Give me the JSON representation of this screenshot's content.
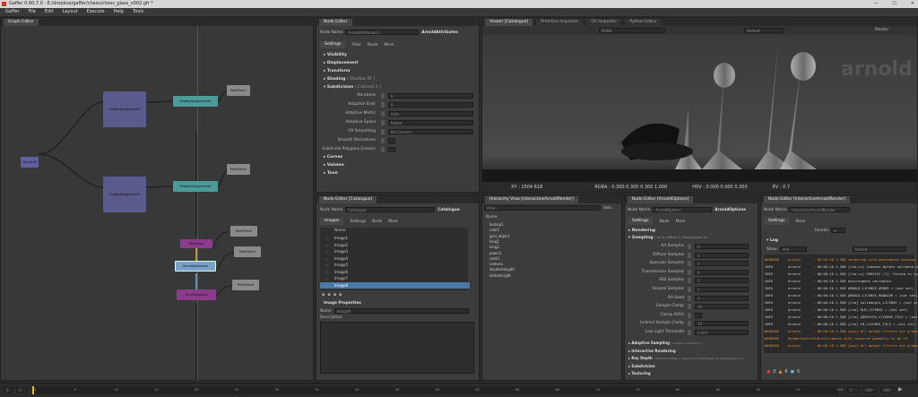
{
  "window": {
    "title": "Gaffer 0.60.7.0 : E:/dropbox/gaffer/chess/chess_glass_v002.gfr *",
    "min": "—",
    "max": "☐",
    "close": "✕"
  },
  "menu": [
    "Gaffer",
    "File",
    "Edit",
    "Layout",
    "Execute",
    "Help",
    "Tools"
  ],
  "graph_editor": {
    "tab": "Graph Editor",
    "nodes": {
      "group": "Group16",
      "sbs1": "ShaderAssignment1",
      "sbs2": "ShaderAssignment2",
      "sbs3": "ShaderAssignment3",
      "sbs4": "ShaderAssignment4",
      "path1": "PathFilter1",
      "path2": "PathFilter2",
      "mesh": "MeshType",
      "attrs": "ArnoldAttributes",
      "opts": "ArnoldOptions",
      "pf3": "PathFilter3",
      "pf4": "PathFilter4",
      "pf5": "PathFilter5"
    }
  },
  "node_editor_top": {
    "tab": "Node Editor",
    "name_label": "Node Name",
    "name_value": "ArnoldAttributes1",
    "type": "ArnoldAttributes",
    "tabs": [
      "Settings",
      "Filter",
      "Node",
      "More"
    ],
    "sections": [
      "Visibility",
      "Displacement",
      "Transform"
    ],
    "shading": "Shading",
    "shading_sub": "( Shadow RT )",
    "subdiv": "Subdivision",
    "subdiv_sub": "( Catclark 1 )",
    "params": [
      {
        "label": "Iterations",
        "value": "0"
      },
      {
        "label": "Adaptive Error",
        "value": "0"
      },
      {
        "label": "Adaptive Metric",
        "value": "Auto"
      },
      {
        "label": "Adaptive Space",
        "value": "Raster"
      },
      {
        "label": "UV Smoothing",
        "value": "Pin Corners"
      },
      {
        "label": "Smooth Derivatives",
        "value": ""
      },
      {
        "label": "Subdivide Polygons (Linear)",
        "value": ""
      }
    ],
    "bottom_sections": [
      "Curves",
      "Volume",
      "Toon"
    ]
  },
  "viewer": {
    "tabs": [
      "Viewer [Catalogue]",
      "Primitive Inspector",
      "UV Inspector",
      "Python Editor"
    ],
    "channel": "RGBA",
    "display": "Default",
    "render_label": "Render",
    "status": {
      "xy": "XY : 1504 618",
      "rgba": "RGBA : 0.300 0.300 0.300 1.000",
      "hsv": "HSV : 0.000 0.000 0.300",
      "ev": "EV : 0.7"
    },
    "watermark": "arnold",
    "watermark2": "arnold"
  },
  "catalogue_editor": {
    "tab": "Node Editor [Catalogue]",
    "name_label": "Node Name",
    "name_value": "Catalogue",
    "type": "Catalogue",
    "tabs": [
      "Images",
      "Settings",
      "Node",
      "More"
    ],
    "col": "Name",
    "images": [
      "Image1",
      "Image2",
      "Image3",
      "Image4",
      "Image5",
      "Image6",
      "Image7",
      "Image8"
    ],
    "props_title": "Image Properties",
    "prop_name_label": "Name",
    "prop_name_value": "Image8",
    "desc_label": "Description"
  },
  "hierarchy": {
    "tab": "Hierarchy View [InteractiveArnoldRender]",
    "filter_ph": "Filter...",
    "sets": "Sets",
    "col": "Name",
    "items": [
      "bishop1",
      "cam1",
      "grid_object",
      "king1",
      "king2",
      "pawn1",
      "rook1",
      "camera",
      "skydomeLight",
      "distantLight"
    ]
  },
  "options_editor": {
    "tab": "Node Editor [ArnoldOptions]",
    "name_label": "Node Name",
    "name_value": "ArnoldOptions",
    "type": "ArnoldOptions",
    "tabs": [
      "Settings",
      "Node",
      "More"
    ],
    "rendering": "Rendering",
    "sampling": "Sampling",
    "sampling_sub": "( AA 6, Diffuse 3, Transmission 6 )",
    "params": [
      {
        "label": "AA Samples",
        "value": "6"
      },
      {
        "label": "Diffuse Samples",
        "value": "3"
      },
      {
        "label": "Specular Samples",
        "value": "2"
      },
      {
        "label": "Transmission Samples",
        "value": "6"
      },
      {
        "label": "SSS Samples",
        "value": "2"
      },
      {
        "label": "Volume Samples",
        "value": "2"
      },
      {
        "label": "AA Seed",
        "value": "1"
      },
      {
        "label": "Sample Clamp",
        "value": "10"
      },
      {
        "label": "Clamp AOVs",
        "value": ""
      },
      {
        "label": "Indirect Sample Clamp",
        "value": "10"
      },
      {
        "label": "Low Light Threshold",
        "value": "0.001"
      }
    ],
    "bottom": [
      {
        "t": "Adaptive Sampling",
        "s": "( Enable 1, AA Max 5 )"
      },
      {
        "t": "Interactive Rendering",
        "s": ""
      },
      {
        "t": "Ray Depth",
        "s": "( Total 10, Diffuse 1, Specular 4, Transmission 8, Transparency 10 )"
      },
      {
        "t": "Subdivision",
        "s": ""
      },
      {
        "t": "Texturing",
        "s": ""
      }
    ]
  },
  "render_editor": {
    "tab": "Node Editor [InteractiveArnoldRender]",
    "name_label": "Node Name",
    "name_value": "InteractiveArnoldRender",
    "tabs": [
      "Settings",
      "More"
    ],
    "render_label": "Render",
    "log": "Log",
    "show_label": "Show",
    "show_value": "Info",
    "search_ph": "Search",
    "lines": [
      {
        "lvl": "WARNING",
        "src": "Arnold",
        "msg": ": 00:00:10  1.5GB  rendering with watermarks because of"
      },
      {
        "lvl": "INFO",
        "src": "Arnold",
        "msg": ": 00:00:10  1.5GB  [clm.cs] timeout before callback was"
      },
      {
        "lvl": "INFO",
        "src": "Arnold",
        "msg": ": 00:00:10  1.5GB  [clm.cs] SERVICE (1): Failed to look"
      },
      {
        "lvl": "INFO",
        "src": "Arnold",
        "msg": ": 00:00:10  1.5GB  environment variables:"
      },
      {
        "lvl": "INFO",
        "src": "Arnold",
        "msg": ": 00:00:10  1.5GB        ARNOLD_LICENSE_ORDER = (not set)"
      },
      {
        "lvl": "INFO",
        "src": "Arnold",
        "msg": ": 00:00:10  1.5GB        ARNOLD_LICENSE_MANAGER = (not set)"
      },
      {
        "lvl": "INFO",
        "src": "Arnold",
        "msg": ": 00:00:10  1.5GB  [clm]  solidangle_LICENSE  = (not set)"
      },
      {
        "lvl": "INFO",
        "src": "Arnold",
        "msg": ": 00:00:10  1.5GB  [clm]  RLM_LICENSE  = (not set)"
      },
      {
        "lvl": "INFO",
        "src": "Arnold",
        "msg": ": 00:00:10  1.5GB  [clm]  ADSKFLEX_LICENSE_FILE = (not set)"
      },
      {
        "lvl": "INFO",
        "src": "Arnold",
        "msg": ": 00:00:10  1.5GB  [clm]  LM_LICENSE_FILE  = (not set)"
      },
      {
        "lvl": "WARNING",
        "src": "Arnold",
        "msg": ": 00:00:10  1.5GB  [aov] all output filters not globally"
      },
      {
        "lvl": "WARNING",
        "src": "RenderController",
        "msg": ": 1 attributes with required geometry to be re"
      },
      {
        "lvl": "WARNING",
        "src": "Arnold",
        "msg": ": 00:00:10  1.5GB  [aov] all output filters not globally"
      }
    ],
    "counts": {
      "err": "0",
      "warn": "6",
      "info": "5"
    }
  },
  "timeline": {
    "start": "1",
    "start2": "1",
    "current": "1",
    "end": "100",
    "end2": "100",
    "ticks": [
      "1",
      "5",
      "10",
      "15",
      "20",
      "25",
      "30",
      "35",
      "40",
      "45",
      "50",
      "55",
      "60",
      "65",
      "70",
      "75",
      "80",
      "85",
      "90",
      "95",
      "100"
    ]
  },
  "colors": {
    "shader": "#5a5a8c",
    "assign": "#4c9a9a",
    "filter": "#8a8a8a",
    "group": "#6060a0",
    "attrs": "#8c3c8c",
    "opts": "#7aa0c8",
    "wire_top": "#e0c030",
    "wire_mid": "#6ab0d8"
  }
}
